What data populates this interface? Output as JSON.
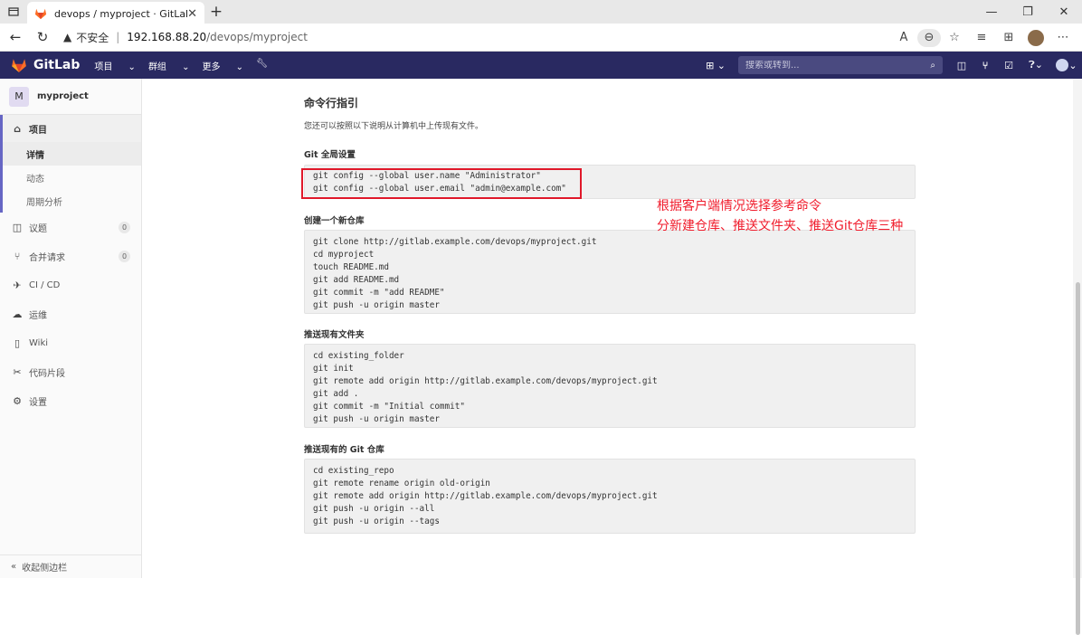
{
  "browser": {
    "tab_title": "devops / myproject · GitLab",
    "url_insecure": "不安全",
    "url_separator": "|",
    "url_host": "192.168.88.20",
    "url_path": "/devops/myproject"
  },
  "header": {
    "brand": "GitLab",
    "menu": [
      "项目",
      "群组",
      "更多"
    ],
    "search_placeholder": "搜索或转到..."
  },
  "sidebar": {
    "project_initial": "M",
    "project_name": "myproject",
    "items": [
      {
        "label": "项目",
        "icon": "home-icon"
      },
      {
        "label": "详情"
      },
      {
        "label": "动态"
      },
      {
        "label": "周期分析"
      },
      {
        "label": "议题",
        "icon": "issues-icon",
        "count": "0"
      },
      {
        "label": "合并请求",
        "icon": "merge-request-icon",
        "count": "0"
      },
      {
        "label": "CI / CD",
        "icon": "rocket-icon"
      },
      {
        "label": "运维",
        "icon": "cloud-icon"
      },
      {
        "label": "Wiki",
        "icon": "book-icon"
      },
      {
        "label": "代码片段",
        "icon": "scissors-icon"
      },
      {
        "label": "设置",
        "icon": "gear-icon"
      }
    ],
    "collapse": "收起侧边栏"
  },
  "main": {
    "title": "命令行指引",
    "intro": "您还可以按照以下说明从计算机中上传现有文件。",
    "sections": [
      {
        "heading": "Git 全局设置",
        "code": "git config --global user.name \"Administrator\"\ngit config --global user.email \"admin@example.com\""
      },
      {
        "heading": "创建一个新仓库",
        "code": "git clone http://gitlab.example.com/devops/myproject.git\ncd myproject\ntouch README.md\ngit add README.md\ngit commit -m \"add README\"\ngit push -u origin master"
      },
      {
        "heading": "推送现有文件夹",
        "code": "cd existing_folder\ngit init\ngit remote add origin http://gitlab.example.com/devops/myproject.git\ngit add .\ngit commit -m \"Initial commit\"\ngit push -u origin master"
      },
      {
        "heading": "推送现有的 Git 仓库",
        "code": "cd existing_repo\ngit remote rename origin old-origin\ngit remote add origin http://gitlab.example.com/devops/myproject.git\ngit push -u origin --all\ngit push -u origin --tags"
      }
    ]
  },
  "annotation": {
    "line1": "根据客户端情况选择参考命令",
    "line2": "分新建仓库、推送文件夹、推送Git仓库三种",
    "color": "#f01c2c"
  },
  "colors": {
    "header_bg": "#292961",
    "accent": "#6666c4",
    "highlight_border": "#e0182a"
  }
}
